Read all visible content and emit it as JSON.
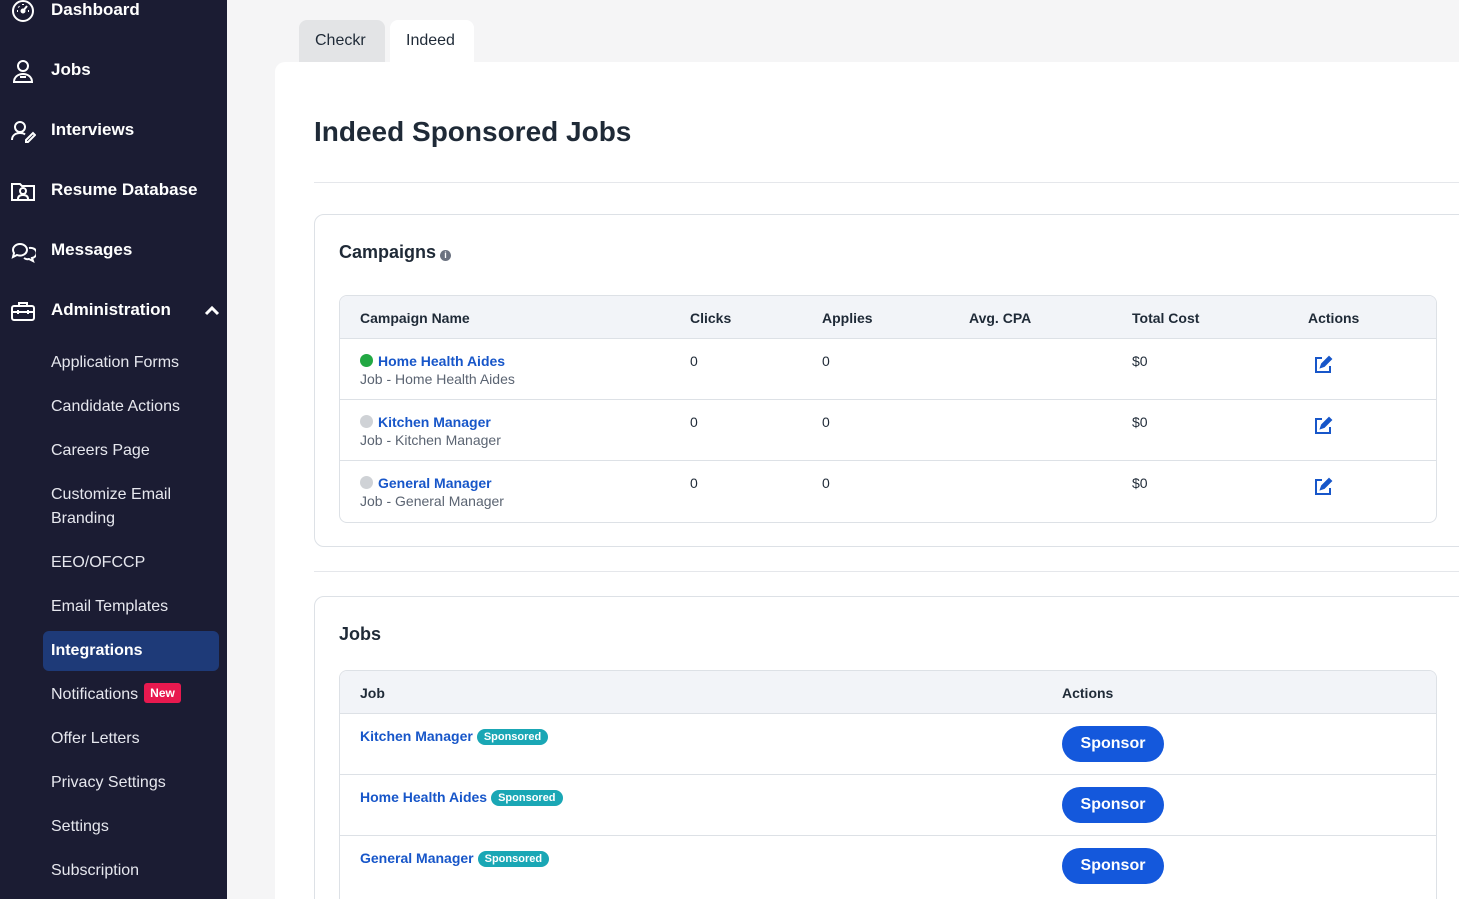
{
  "sidebar": {
    "main_items": [
      {
        "label": "Dashboard",
        "icon": "dashboard-icon"
      },
      {
        "label": "Jobs",
        "icon": "jobs-icon"
      },
      {
        "label": "Interviews",
        "icon": "interviews-icon"
      },
      {
        "label": "Resume Database",
        "icon": "resume-database-icon"
      },
      {
        "label": "Messages",
        "icon": "messages-icon"
      },
      {
        "label": "Administration",
        "icon": "toolbox-icon"
      }
    ],
    "admin_items": [
      "Application Forms",
      "Candidate Actions",
      "Careers Page",
      "Customize Email Branding",
      "EEO/OFCCP",
      "Email Templates",
      "Integrations",
      "Notifications",
      "Offer Letters",
      "Privacy Settings",
      "Settings",
      "Subscription"
    ],
    "active_item": "Integrations",
    "new_badge": "New"
  },
  "tabs": [
    {
      "label": "Checkr",
      "active": false
    },
    {
      "label": "Indeed",
      "active": true
    }
  ],
  "page": {
    "title": "Indeed Sponsored Jobs"
  },
  "campaigns": {
    "title": "Campaigns",
    "info_icon": "info-icon",
    "columns": [
      "Campaign Name",
      "Clicks",
      "Applies",
      "Avg. CPA",
      "Total Cost",
      "Actions"
    ],
    "rows": [
      {
        "name": "Home Health Aides",
        "sub": "Job - Home Health Aides",
        "status": "active",
        "status_color": "#22a843",
        "clicks": "0",
        "applies": "0",
        "avg_cpa": "",
        "total_cost": "$0"
      },
      {
        "name": "Kitchen Manager",
        "sub": "Job - Kitchen Manager",
        "status": "inactive",
        "status_color": "#cfd2d6",
        "clicks": "0",
        "applies": "0",
        "avg_cpa": "",
        "total_cost": "$0"
      },
      {
        "name": "General Manager",
        "sub": "Job - General Manager",
        "status": "inactive",
        "status_color": "#cfd2d6",
        "clicks": "0",
        "applies": "0",
        "avg_cpa": "",
        "total_cost": "$0"
      }
    ]
  },
  "jobs": {
    "title": "Jobs",
    "columns": [
      "Job",
      "Actions"
    ],
    "sponsored_badge": "Sponsored",
    "sponsor_label": "Sponsor",
    "rows": [
      {
        "name": "Kitchen Manager"
      },
      {
        "name": "Home Health Aides"
      },
      {
        "name": "General Manager"
      }
    ]
  },
  "colors": {
    "sidebar_bg": "#1b1c33",
    "active_bg": "#1e3a78",
    "link": "#1756c9",
    "button": "#1458dc",
    "badge_sponsored": "#1aa7b5",
    "badge_new": "#e8194f"
  }
}
